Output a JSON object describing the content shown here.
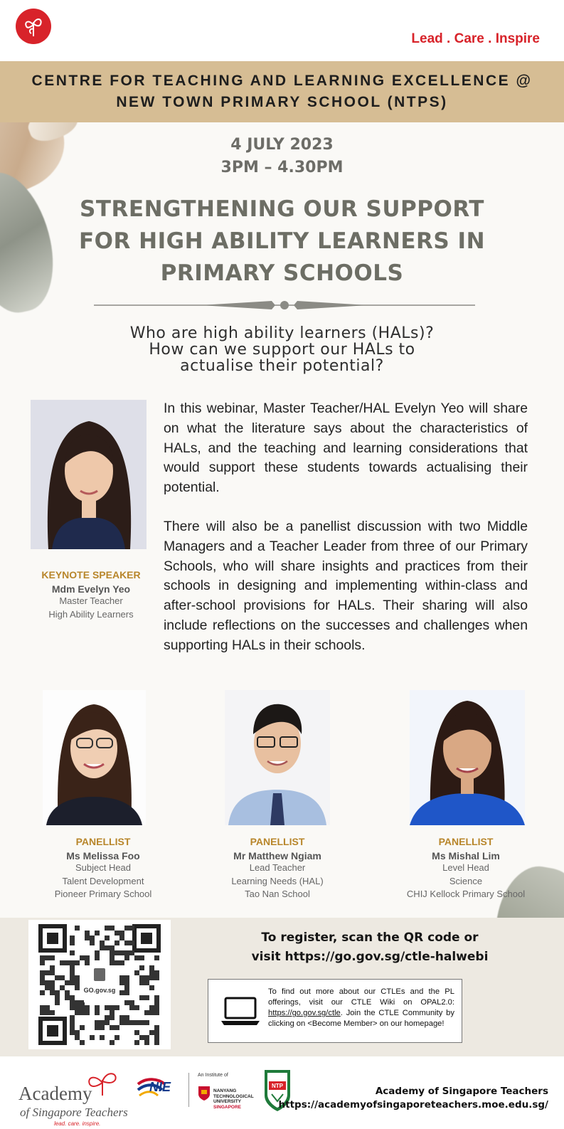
{
  "header": {
    "tagline": "Lead . Care . Inspire",
    "banner_line1": "CENTRE FOR TEACHING AND LEARNING EXCELLENCE @",
    "banner_line2": "NEW TOWN PRIMARY SCHOOL (NTPS)"
  },
  "event": {
    "date": "4 JULY 2023",
    "time": "3PM – 4.30PM",
    "title_line1": "STRENGTHENING OUR SUPPORT",
    "title_line2": "FOR HIGH ABILITY LEARNERS IN",
    "title_line3": "PRIMARY SCHOOLS",
    "question1": "Who are high ability learners (HALs)?",
    "question2": "How can we support our HALs to",
    "question3": "actualise their potential?"
  },
  "keynote": {
    "role": "KEYNOTE SPEAKER",
    "name": "Mdm Evelyn Yeo",
    "detail1": "Master Teacher",
    "detail2": "High Ability Learners"
  },
  "body": {
    "paragraph1": "In this webinar, Master Teacher/HAL Evelyn Yeo will share on what the literature says about the characteristics of HALs, and the teaching and learning considerations that would support these students towards actualising their potential.",
    "paragraph2": "There will also be a panellist discussion with two Middle Managers and a Teacher Leader from three of our Primary Schools, who will share insights and practices from their schools in designing and implementing within-class and after-school provisions for HALs. Their sharing will also include reflections on the successes and challenges when supporting HALs in their schools."
  },
  "panellists": [
    {
      "role": "PANELLIST",
      "name": "Ms Melissa Foo",
      "detail1": "Subject Head",
      "detail2": "Talent Development",
      "detail3": "Pioneer Primary School"
    },
    {
      "role": "PANELLIST",
      "name": "Mr Matthew Ngiam",
      "detail1": "Lead Teacher",
      "detail2": "Learning Needs (HAL)",
      "detail3": "Tao Nan School"
    },
    {
      "role": "PANELLIST",
      "name": "Ms Mishal Lim",
      "detail1": "Level Head",
      "detail2": "Science",
      "detail3": "CHIJ Kellock Primary School"
    }
  ],
  "registration": {
    "line1": "To register, scan the QR code or",
    "line2": "visit https://go.gov.sg/ctle-halwebi",
    "qr_label": "GO.gov.sg",
    "info_text1": "To find out more about our CTLEs and the PL offerings, visit our CTLE Wiki on OPAL2.0:",
    "info_link": "https://go.gov.sg/ctle",
    "info_text2": "Join the CTLE Community by clicking on <Become Member> on our homepage!"
  },
  "footer": {
    "ast_word1": "Academy",
    "ast_word2": "of Singapore Teachers",
    "ast_tag": "lead. care. inspire.",
    "nie": "NIE",
    "nie_inst": "An Institute of",
    "ntu_line1": "NANYANG",
    "ntu_line2": "TECHNOLOGICAL",
    "ntu_line3": "UNIVERSITY",
    "ntu_line4": "SINGAPORE",
    "ntps": "NTP",
    "org_name": "Academy of Singapore Teachers",
    "org_url": "https://academyofsingaporeteachers.moe.edu.sg/"
  },
  "colors": {
    "brand_red": "#d8232a",
    "banner_tan": "#d6bd94",
    "title_grey": "#6d6e65",
    "role_gold": "#b8862b"
  }
}
